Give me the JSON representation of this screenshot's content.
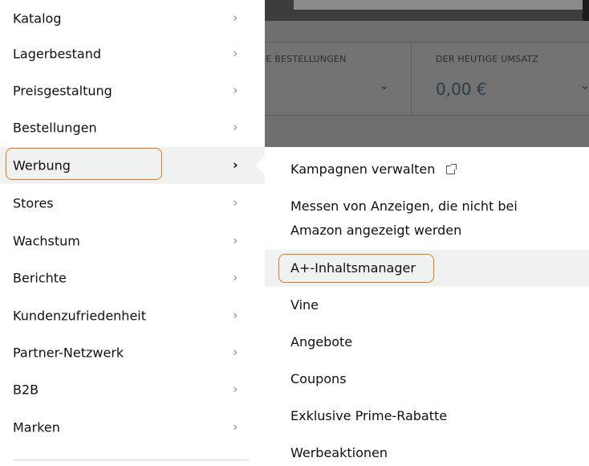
{
  "left_menu": {
    "items": [
      {
        "label": "Katalog"
      },
      {
        "label": "Lagerbestand"
      },
      {
        "label": "Preisgestaltung"
      },
      {
        "label": "Bestellungen"
      },
      {
        "label": "Werbung",
        "active": true
      },
      {
        "label": "Stores"
      },
      {
        "label": "Wachstum"
      },
      {
        "label": "Berichte"
      },
      {
        "label": "Kundenzufriedenheit"
      },
      {
        "label": "Partner-Netzwerk"
      },
      {
        "label": "B2B"
      },
      {
        "label": "Marken"
      }
    ],
    "chevron": "›"
  },
  "submenu": {
    "items": [
      {
        "label": "Kampagnen verwalten",
        "external": true
      },
      {
        "label": "Messen von Anzeigen, die nicht bei",
        "label2": "Amazon angezeigt werden"
      },
      {
        "label": "A+-Inhaltsmanager",
        "highlighted": true
      },
      {
        "label": "Vine"
      },
      {
        "label": "Angebote"
      },
      {
        "label": "Coupons"
      },
      {
        "label": "Exklusive Prime-Rabatte"
      },
      {
        "label": "Werbeaktionen"
      }
    ]
  },
  "background": {
    "card1_label": "NE BESTELLUNGEN",
    "card1_chevron": "⌄",
    "card2_label": "DER HEUTIGE UMSATZ",
    "card2_value": "0,00 €",
    "card2_chevron": "⌄"
  },
  "colors": {
    "highlight": "#e47911",
    "active_bg": "#f0f2f2",
    "text": "#0f1111",
    "chevron": "#8a8f94"
  }
}
